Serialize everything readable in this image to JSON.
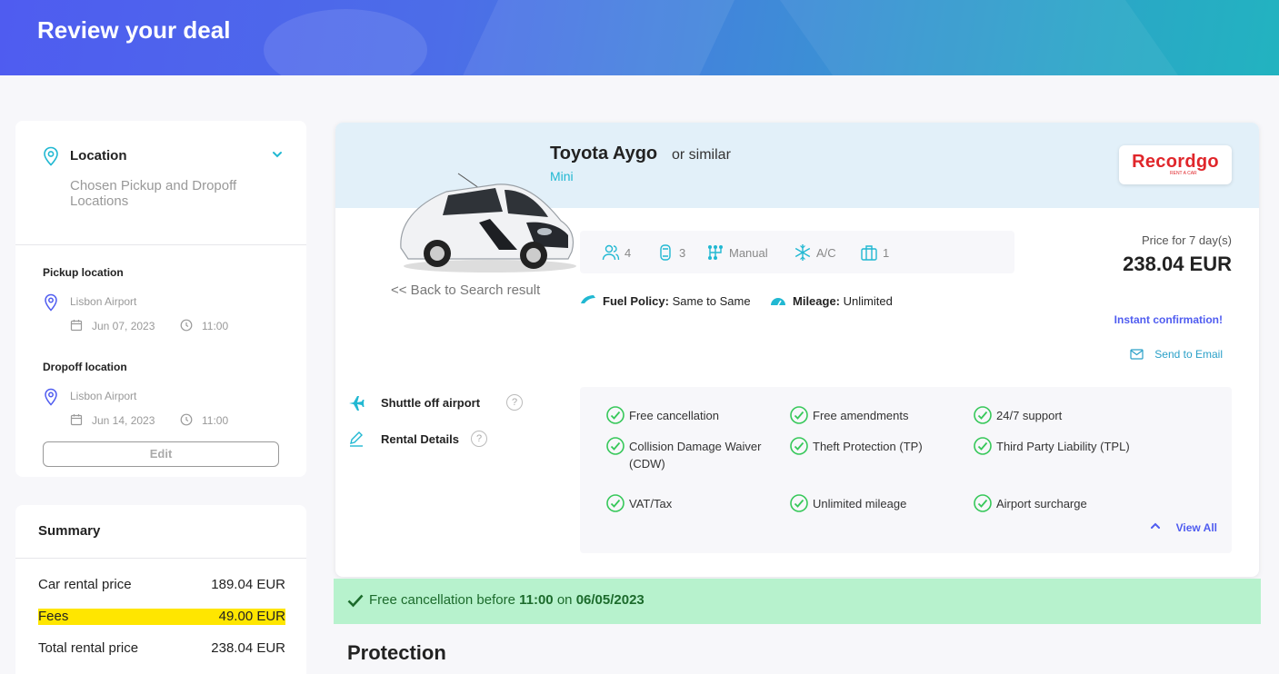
{
  "header": {
    "title": "Review your deal"
  },
  "sidebar": {
    "location": {
      "title": "Location",
      "subtitle": "Chosen Pickup and Dropoff Locations",
      "pickup": {
        "label": "Pickup location",
        "place": "Lisbon Airport",
        "date": "Jun 07, 2023",
        "time": "11:00"
      },
      "dropoff": {
        "label": "Dropoff location",
        "place": "Lisbon Airport",
        "date": "Jun 14, 2023",
        "time": "11:00"
      },
      "edit_label": "Edit"
    },
    "summary": {
      "title": "Summary",
      "rows": [
        {
          "label": "Car rental price",
          "value": "189.04 EUR",
          "highlighted": false
        },
        {
          "label": "Fees",
          "value": "49.00 EUR",
          "highlighted": true
        },
        {
          "label": "Total rental price",
          "value": "238.04 EUR",
          "highlighted": false
        }
      ]
    }
  },
  "deal": {
    "car_name": "Toyota Aygo",
    "or_similar": "or similar",
    "car_class": "Mini",
    "brand": "Recordgo",
    "brand_tagline": "RENT A CAR",
    "back_link": "<< Back to Search result",
    "specs": {
      "passengers": "4",
      "doors": "3",
      "transmission": "Manual",
      "ac": "A/C",
      "luggage": "1"
    },
    "fuel_policy_label": "Fuel Policy:",
    "fuel_policy_value": "Same to Same",
    "mileage_label": "Mileage:",
    "mileage_value": "Unlimited",
    "price_label": "Price for 7 day(s)",
    "price": "238.04 EUR",
    "instant_confirmation": "Instant confirmation!",
    "send_email": "Send to Email",
    "extras": [
      {
        "label": "Shuttle off airport"
      },
      {
        "label": "Rental Details"
      }
    ],
    "inclusions": [
      "Free cancellation",
      "Free amendments",
      "24/7 support",
      "Collision Damage Waiver (CDW)",
      "Theft Protection (TP)",
      "Third Party Liability (TPL)",
      "VAT/Tax",
      "Unlimited mileage",
      "Airport surcharge"
    ],
    "view_all": "View All"
  },
  "cancellation": {
    "prefix": "Free cancellation before",
    "time": "11:00",
    "middle": "on",
    "date": "06/05/2023"
  },
  "protection_title": "Protection",
  "colors": {
    "accent": "#4f5cf0",
    "teal": "#21b8d2",
    "green_bg": "#b7f2cd",
    "highlight": "#ffe600"
  }
}
